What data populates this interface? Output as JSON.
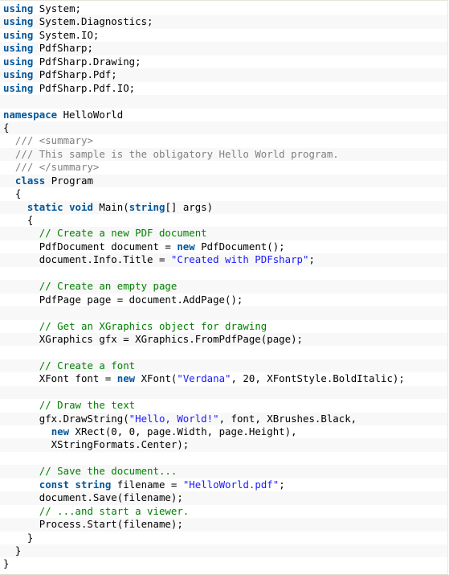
{
  "colors": {
    "keyword": "#00569b",
    "comment": "#008000",
    "doc_comment": "#808080",
    "string": "#1a1aff",
    "text": "#000000",
    "stripe": "#f8f8f8"
  },
  "code_lines": [
    [
      {
        "t": "kw",
        "v": "using"
      },
      {
        "t": "tx",
        "v": " System;"
      }
    ],
    [
      {
        "t": "kw",
        "v": "using"
      },
      {
        "t": "tx",
        "v": " System.Diagnostics;"
      }
    ],
    [
      {
        "t": "kw",
        "v": "using"
      },
      {
        "t": "tx",
        "v": " System.IO;"
      }
    ],
    [
      {
        "t": "kw",
        "v": "using"
      },
      {
        "t": "tx",
        "v": " PdfSharp;"
      }
    ],
    [
      {
        "t": "kw",
        "v": "using"
      },
      {
        "t": "tx",
        "v": " PdfSharp.Drawing;"
      }
    ],
    [
      {
        "t": "kw",
        "v": "using"
      },
      {
        "t": "tx",
        "v": " PdfSharp.Pdf;"
      }
    ],
    [
      {
        "t": "kw",
        "v": "using"
      },
      {
        "t": "tx",
        "v": " PdfSharp.Pdf.IO;"
      }
    ],
    [],
    [
      {
        "t": "kw",
        "v": "namespace"
      },
      {
        "t": "tx",
        "v": " HelloWorld"
      }
    ],
    [
      {
        "t": "tx",
        "v": "{"
      }
    ],
    [
      {
        "t": "tx",
        "v": "  "
      },
      {
        "t": "doc",
        "v": "/// <summary>"
      }
    ],
    [
      {
        "t": "tx",
        "v": "  "
      },
      {
        "t": "doc",
        "v": "/// This sample is the obligatory Hello World program."
      }
    ],
    [
      {
        "t": "tx",
        "v": "  "
      },
      {
        "t": "doc",
        "v": "/// </summary>"
      }
    ],
    [
      {
        "t": "tx",
        "v": "  "
      },
      {
        "t": "kw",
        "v": "class"
      },
      {
        "t": "tx",
        "v": " Program"
      }
    ],
    [
      {
        "t": "tx",
        "v": "  {"
      }
    ],
    [
      {
        "t": "tx",
        "v": "    "
      },
      {
        "t": "kw",
        "v": "static"
      },
      {
        "t": "tx",
        "v": " "
      },
      {
        "t": "kw",
        "v": "void"
      },
      {
        "t": "tx",
        "v": " Main("
      },
      {
        "t": "kw",
        "v": "string"
      },
      {
        "t": "tx",
        "v": "[] args)"
      }
    ],
    [
      {
        "t": "tx",
        "v": "    {"
      }
    ],
    [
      {
        "t": "tx",
        "v": "      "
      },
      {
        "t": "cm",
        "v": "// Create a new PDF document"
      }
    ],
    [
      {
        "t": "tx",
        "v": "      PdfDocument document = "
      },
      {
        "t": "kw",
        "v": "new"
      },
      {
        "t": "tx",
        "v": " PdfDocument();"
      }
    ],
    [
      {
        "t": "tx",
        "v": "      document.Info.Title = "
      },
      {
        "t": "str",
        "v": "\"Created with PDFsharp\""
      },
      {
        "t": "tx",
        "v": ";"
      }
    ],
    [],
    [
      {
        "t": "tx",
        "v": "      "
      },
      {
        "t": "cm",
        "v": "// Create an empty page"
      }
    ],
    [
      {
        "t": "tx",
        "v": "      PdfPage page = document.AddPage();"
      }
    ],
    [],
    [
      {
        "t": "tx",
        "v": "      "
      },
      {
        "t": "cm",
        "v": "// Get an XGraphics object for drawing"
      }
    ],
    [
      {
        "t": "tx",
        "v": "      XGraphics gfx = XGraphics.FromPdfPage(page);"
      }
    ],
    [],
    [
      {
        "t": "tx",
        "v": "      "
      },
      {
        "t": "cm",
        "v": "// Create a font"
      }
    ],
    [
      {
        "t": "tx",
        "v": "      XFont font = "
      },
      {
        "t": "kw",
        "v": "new"
      },
      {
        "t": "tx",
        "v": " XFont("
      },
      {
        "t": "str",
        "v": "\"Verdana\""
      },
      {
        "t": "tx",
        "v": ", 20, XFontStyle.BoldItalic);"
      }
    ],
    [],
    [
      {
        "t": "tx",
        "v": "      "
      },
      {
        "t": "cm",
        "v": "// Draw the text"
      }
    ],
    [
      {
        "t": "tx",
        "v": "      gfx.DrawString("
      },
      {
        "t": "str",
        "v": "\"Hello, World!\""
      },
      {
        "t": "tx",
        "v": ", font, XBrushes.Black,"
      }
    ],
    [
      {
        "t": "tx",
        "v": "        "
      },
      {
        "t": "kw",
        "v": "new"
      },
      {
        "t": "tx",
        "v": " XRect(0, 0, page.Width, page.Height),"
      }
    ],
    [
      {
        "t": "tx",
        "v": "        XStringFormats.Center);"
      }
    ],
    [],
    [
      {
        "t": "tx",
        "v": "      "
      },
      {
        "t": "cm",
        "v": "// Save the document..."
      }
    ],
    [
      {
        "t": "tx",
        "v": "      "
      },
      {
        "t": "kw",
        "v": "const"
      },
      {
        "t": "tx",
        "v": " "
      },
      {
        "t": "kw",
        "v": "string"
      },
      {
        "t": "tx",
        "v": " filename = "
      },
      {
        "t": "str",
        "v": "\"HelloWorld.pdf\""
      },
      {
        "t": "tx",
        "v": ";"
      }
    ],
    [
      {
        "t": "tx",
        "v": "      document.Save(filename);"
      }
    ],
    [
      {
        "t": "tx",
        "v": "      "
      },
      {
        "t": "cm",
        "v": "// ...and start a viewer."
      }
    ],
    [
      {
        "t": "tx",
        "v": "      Process.Start(filename);"
      }
    ],
    [
      {
        "t": "tx",
        "v": "    }"
      }
    ],
    [
      {
        "t": "tx",
        "v": "  }"
      }
    ],
    [
      {
        "t": "tx",
        "v": "}"
      }
    ]
  ]
}
